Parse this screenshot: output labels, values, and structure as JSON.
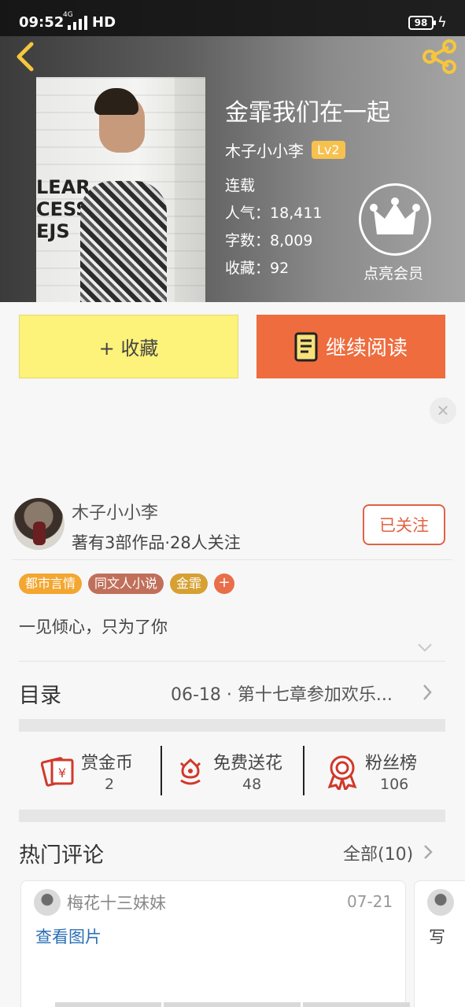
{
  "status_bar": {
    "time": "09:52",
    "network": "4G",
    "hd": "HD",
    "battery": "98"
  },
  "book": {
    "title": "金霏我们在一起",
    "author": "木子小小李",
    "level": "Lv2",
    "status": "连载",
    "popularity_label": "人气：",
    "popularity": "18,411",
    "words_label": "字数：",
    "words": "8,009",
    "favorites_label": "收藏：",
    "favorites": "92",
    "cover_signs": [
      "LEAR",
      "CESS",
      "EJS"
    ],
    "vip_label": "点亮会员"
  },
  "actions": {
    "collect_label": "+ 收藏",
    "read_label": "继续阅读"
  },
  "author_card": {
    "name": "木子小小李",
    "stats": "著有3部作品·28人关注",
    "follow_label": "已关注"
  },
  "tags": [
    {
      "label": "都市言情",
      "color": "#f3a630"
    },
    {
      "label": "同文人小说",
      "color": "#c0705a"
    },
    {
      "label": "金霏",
      "color": "#d6a033"
    }
  ],
  "tag_add": "+",
  "summary": "一见倾心，只为了你",
  "toc": {
    "title": "目录",
    "latest": "06-18 · 第十七章参加欢乐..."
  },
  "stats": [
    {
      "label": "赏金币",
      "value": "2",
      "icon": "red-envelope-icon"
    },
    {
      "label": "免费送花",
      "value": "48",
      "icon": "flower-icon"
    },
    {
      "label": "粉丝榜",
      "value": "106",
      "icon": "ribbon-medal-icon"
    }
  ],
  "comments": {
    "title": "热门评论",
    "all_label": "全部(10)",
    "items": [
      {
        "user": "梅花十三妹妹",
        "date": "07-21",
        "body": "查看图片"
      },
      {
        "user": "",
        "date": "",
        "body": "写"
      }
    ]
  },
  "colors": {
    "accent": "#ee6c3e",
    "collect_bg": "#fdf27a",
    "link": "#2b6fb6",
    "icon_red": "#d0392b"
  }
}
